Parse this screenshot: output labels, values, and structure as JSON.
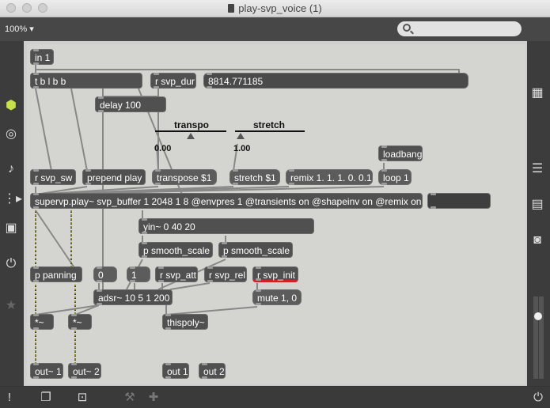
{
  "window": {
    "title": "play-svp_voice (1)"
  },
  "toolbar": {
    "zoom": "100%",
    "zoom_caret": "▾",
    "search_placeholder": ""
  },
  "objects": {
    "in1": "in 1",
    "tbbb": "t b l b b",
    "rsvpdur": "r svp_dur",
    "durval": "8814.771185",
    "delay": "delay 100",
    "transpo_label": "transpo",
    "stretch_label": "stretch",
    "transpo_val": "0.00",
    "stretch_val": "1.00",
    "loadbang": "loadbang",
    "rsvpsw": "r svp_sw",
    "prependplay": "prepend play",
    "transpose": "transpose $1",
    "stretchmsg": "stretch $1",
    "remix": "remix 1. 1. 1. 0. 0.1",
    "loop": "loop 1",
    "supervp": "supervp.play~ svp_buffer 1 2048 1 8 @envpres 1 @transients on @shapeinv on @remix on",
    "yin": "yin~ 0 40 20",
    "smooth1": "p smooth_scale",
    "smooth2": "p smooth_scale",
    "panning": "p panning",
    "zero": "0",
    "one": "1",
    "rsvpatt": "r svp_att",
    "rsvprel": "r svp_rel",
    "rsvpinit": "r svp_init",
    "adsr": "adsr~ 10 5 1 200",
    "mute": "mute 1, 0",
    "mul1": "*~",
    "mul2": "*~",
    "thispoly": "thispoly~",
    "out1": "out~ 1",
    "out2": "out~ 2",
    "outa": "out 1",
    "outb": "out 2"
  },
  "colors": {
    "accent_red": "#d42020",
    "patch_bg": "#d4d4d0",
    "object_bg": "#505050"
  }
}
